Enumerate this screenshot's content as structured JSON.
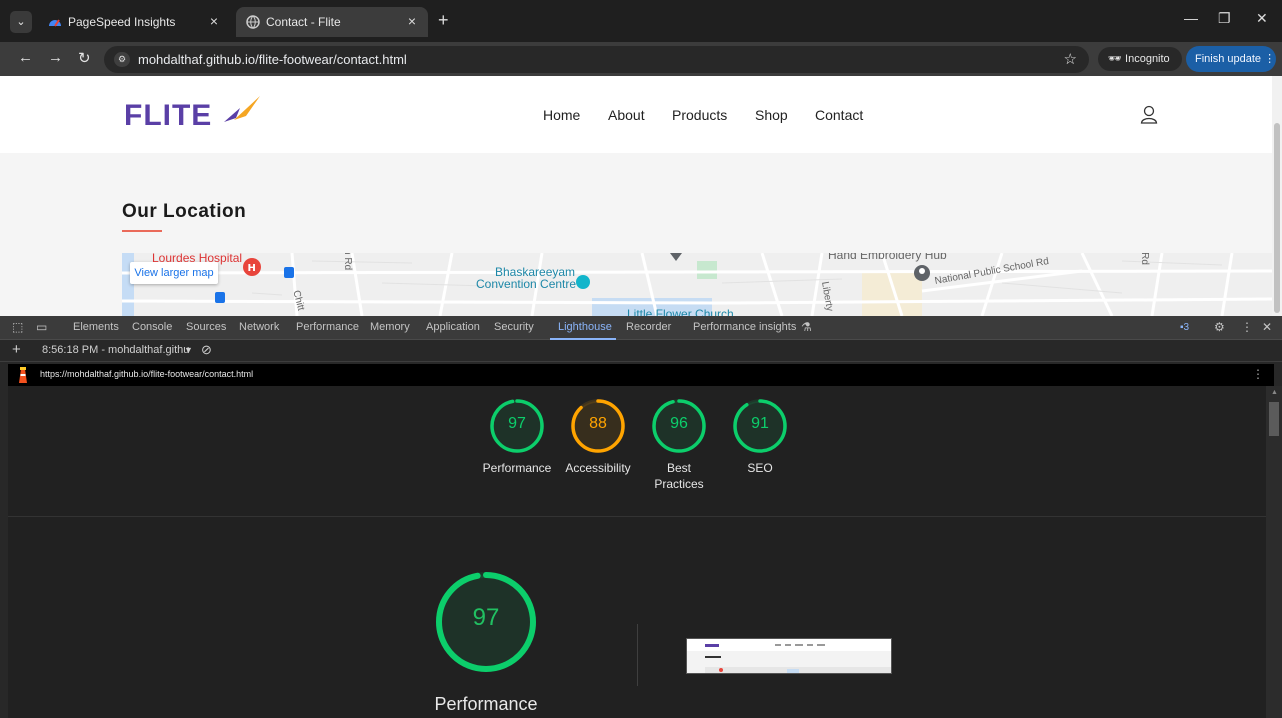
{
  "browser": {
    "tabs": [
      {
        "title": "PageSpeed Insights",
        "active": false
      },
      {
        "title": "Contact - Flite",
        "active": true
      }
    ],
    "url": "mohdalthaf.github.io/flite-footwear/contact.html",
    "incognito_label": "Incognito",
    "finish_update_label": "Finish update"
  },
  "site": {
    "logo": "FLITE",
    "nav": [
      "Home",
      "About",
      "Products",
      "Shop",
      "Contact"
    ],
    "section_title": "Our Location",
    "map": {
      "view_larger": "View larger map",
      "labels": {
        "hospital": "Lourdes Hospital",
        "convention": "Bhaskareeyam",
        "convention2": "Convention Centre",
        "church": "Little Flower Church",
        "hub": "Hand Embroidery Hub",
        "school": "National Public School Rd",
        "liberty": "Liberty",
        "rd": "Rd",
        "rd2": "in Rd",
        "chit": "Chitt"
      }
    }
  },
  "devtools": {
    "tabs": [
      "Elements",
      "Console",
      "Sources",
      "Network",
      "Performance",
      "Memory",
      "Application",
      "Security",
      "Lighthouse",
      "Recorder",
      "Performance insights"
    ],
    "active_tab": "Lighthouse",
    "issues_count": "3",
    "report_time": "8:56:18 PM - mohdalthaf.githu",
    "report_url": "https://mohdalthaf.github.io/flite-footwear/contact.html"
  },
  "lighthouse": {
    "scores": [
      {
        "label": "Performance",
        "value": 97,
        "color": "#0cce6b"
      },
      {
        "label": "Accessibility",
        "value": 88,
        "color": "#ffa400"
      },
      {
        "label": "Best Practices",
        "value": 96,
        "color": "#0cce6b"
      },
      {
        "label": "SEO",
        "value": 91,
        "color": "#0cce6b"
      }
    ],
    "main": {
      "label": "Performance",
      "value": 97
    }
  },
  "colors": {
    "pass": "#0cce6b",
    "average": "#ffa400",
    "brand": "#5a3fa6"
  }
}
